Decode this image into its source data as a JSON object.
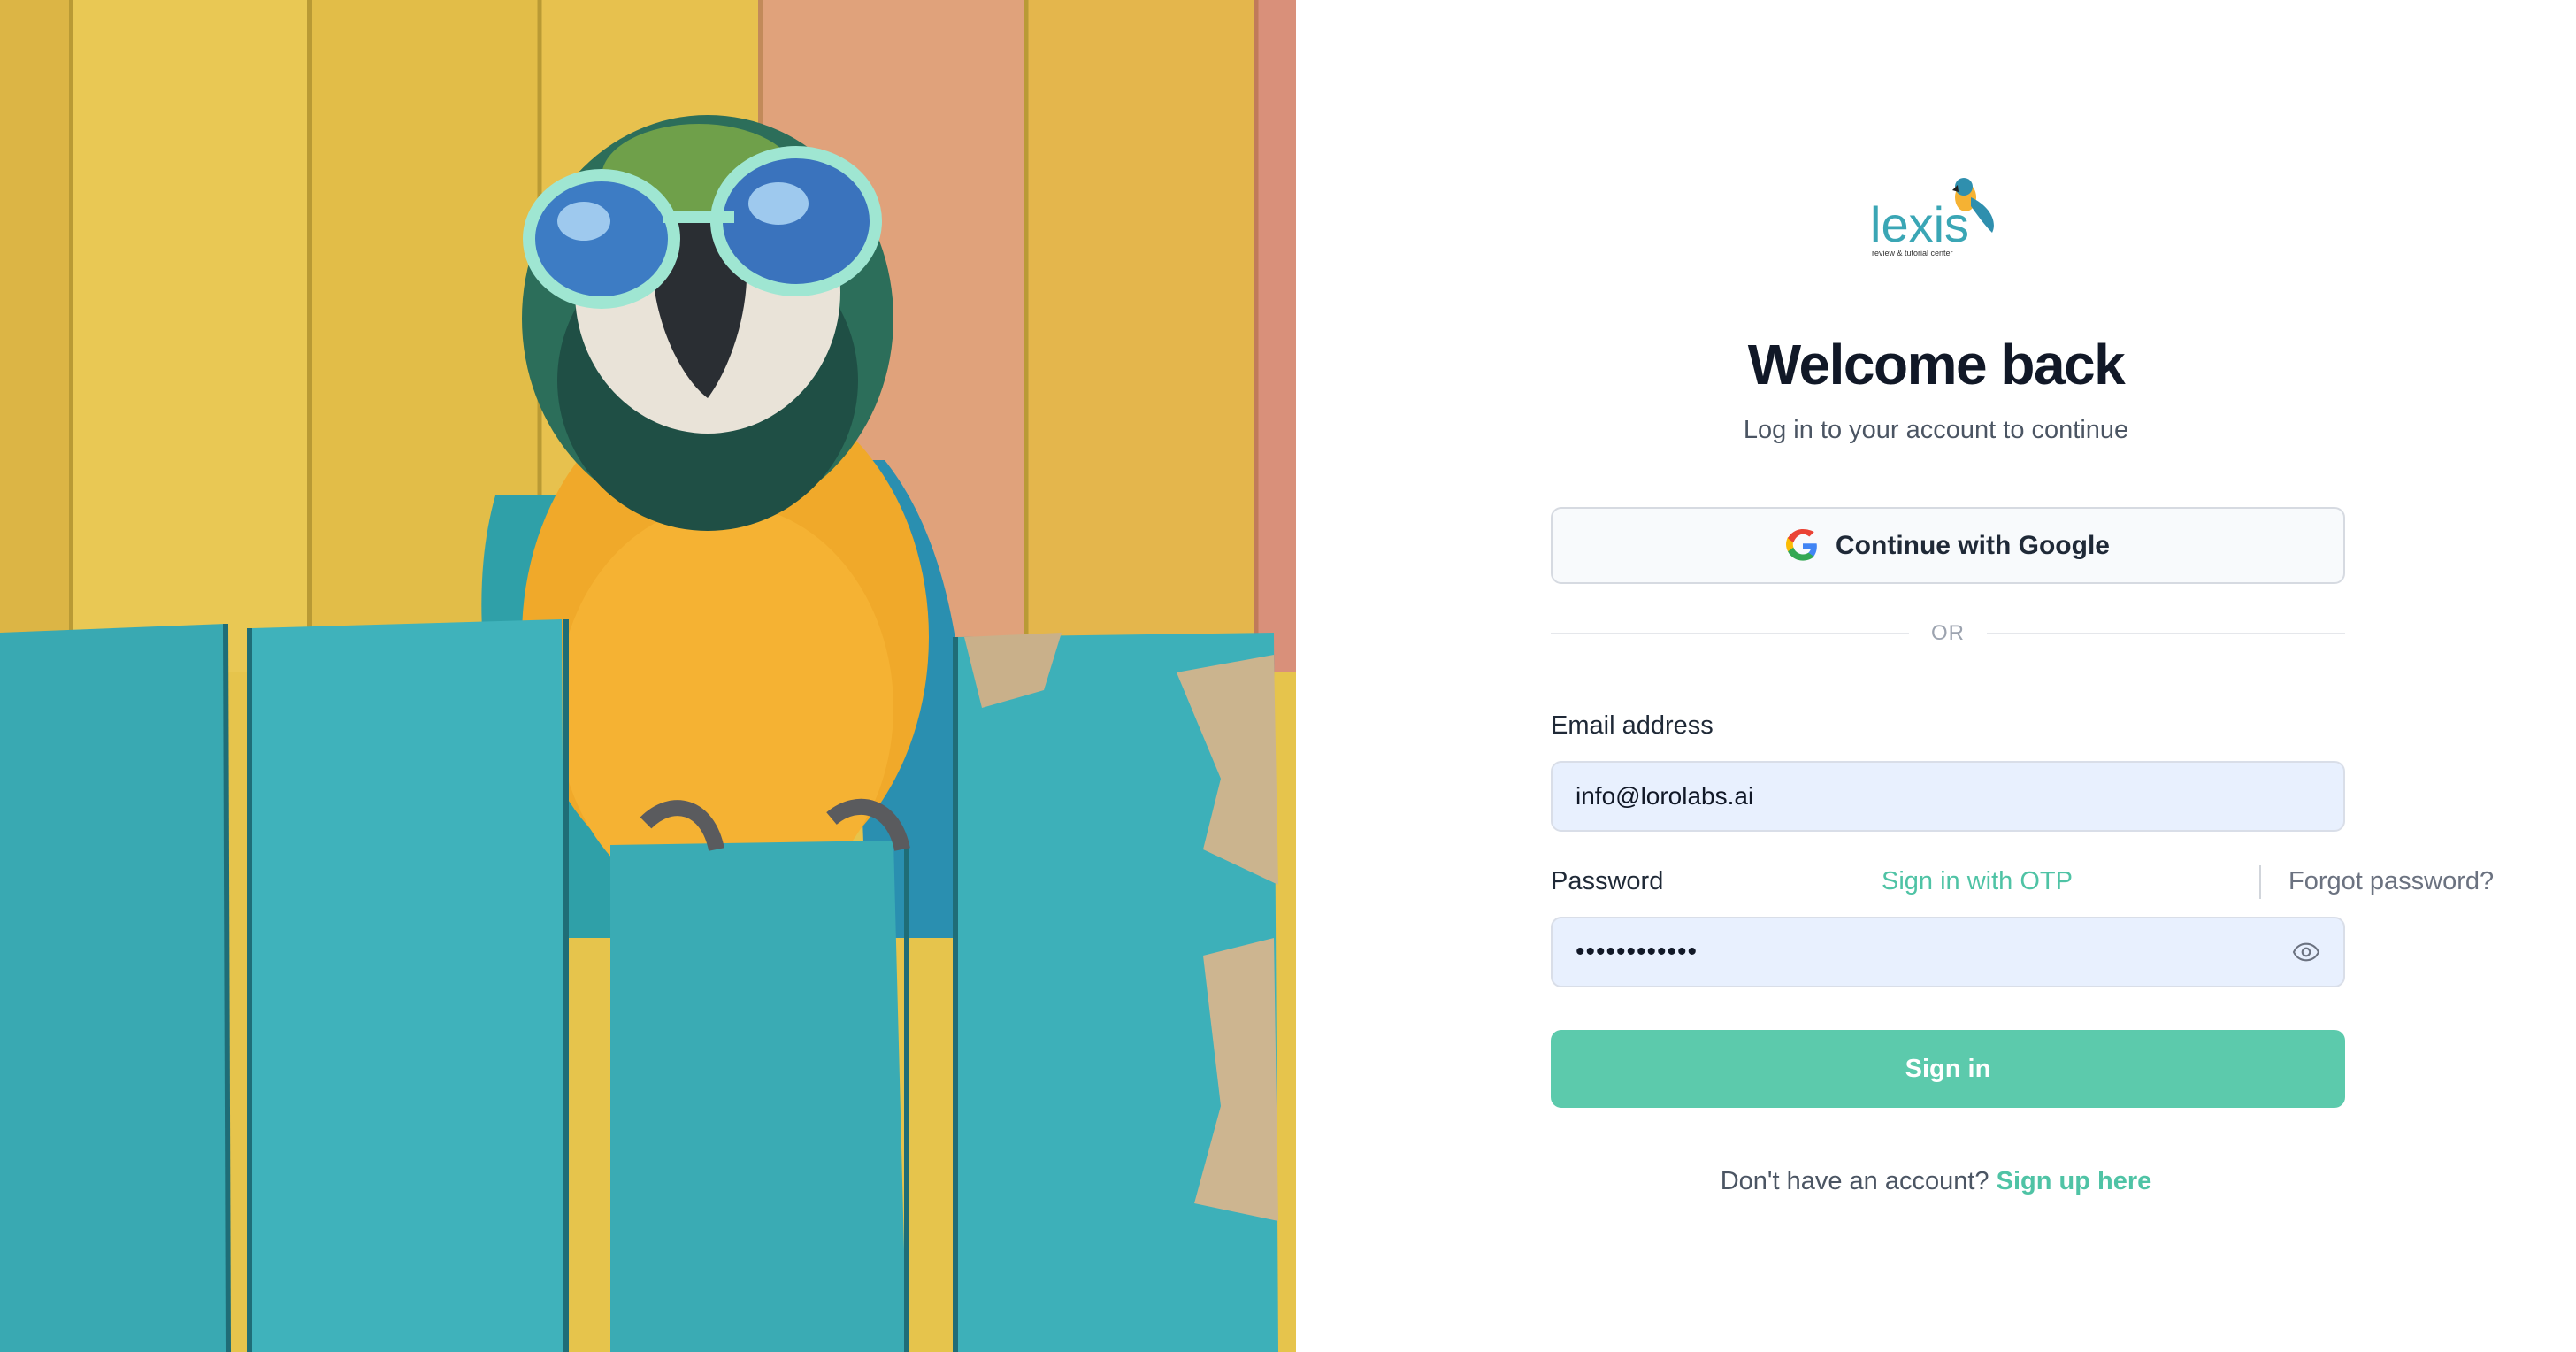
{
  "hero": {
    "image_alt": "Macaw parrot wearing sunglasses perched on a teal wooden fence"
  },
  "brand": {
    "logo_word": "lexis",
    "logo_tagline": "review & tutorial center"
  },
  "header": {
    "title": "Welcome back",
    "subtitle": "Log in to your account to continue"
  },
  "social": {
    "google_label": "Continue with Google",
    "icon": "google-icon"
  },
  "divider": {
    "label": "OR"
  },
  "form": {
    "email_label": "Email address",
    "email_value": "info@lorolabs.ai",
    "password_label": "Password",
    "password_value": "••••••••••••",
    "otp_link": "Sign in with OTP",
    "forgot_link": "Forgot password?",
    "submit_label": "Sign in",
    "show_password_icon": "eye-icon"
  },
  "footer": {
    "prompt": "Don't have an account?",
    "signup_link": "Sign up here"
  },
  "colors": {
    "accent": "#5ccaac",
    "link": "#4fc3a5",
    "input_bg": "#e8f0fe"
  }
}
